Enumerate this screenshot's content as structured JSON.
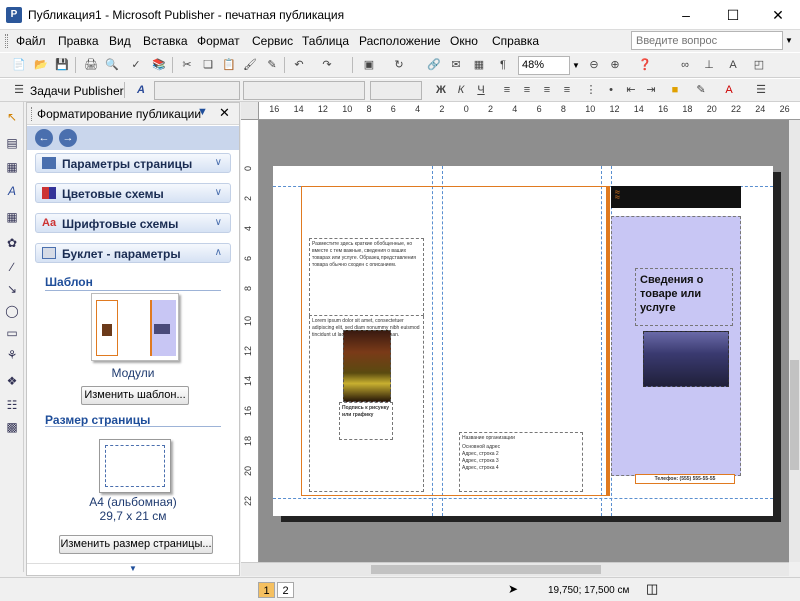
{
  "window": {
    "title": "Публикация1 - Microsoft Publisher - печатная публикация",
    "app_icon": "publisher-icon"
  },
  "menu": {
    "items": [
      "Файл",
      "Правка",
      "Вид",
      "Вставка",
      "Формат",
      "Сервис",
      "Таблица",
      "Расположение",
      "Окно",
      "Справка"
    ],
    "ask_placeholder": "Введите вопрос"
  },
  "toolbar": {
    "zoom": "48%",
    "tasks_label": "Задачи Publisher"
  },
  "taskpane": {
    "title": "Форматирование публикации",
    "sections": [
      {
        "label": "Параметры страницы"
      },
      {
        "label": "Цветовые схемы"
      },
      {
        "label": "Шрифтовые схемы"
      },
      {
        "label": "Буклет - параметры"
      }
    ],
    "template_heading": "Шаблон",
    "template_name": "Модули",
    "change_template": "Изменить шаблон...",
    "pagesize_heading": "Размер страницы",
    "pagesize_name": "A4 (альбомная)",
    "pagesize_dims": "29,7 x 21 см",
    "change_pagesize": "Изменить размер страницы..."
  },
  "rulers": {
    "h": [
      "18",
      "16",
      "14",
      "12",
      "10",
      "8",
      "6",
      "4",
      "2",
      "0",
      "2",
      "4",
      "6",
      "8",
      "10",
      "12",
      "14",
      "16",
      "18",
      "20",
      "22",
      "24",
      "26",
      "28",
      "30"
    ],
    "v": [
      "0",
      "2",
      "4",
      "6",
      "8",
      "10",
      "12",
      "14",
      "16",
      "18",
      "20",
      "22"
    ]
  },
  "document": {
    "heading": "Сведения о товаре или услуге",
    "left_text_1": "Разместите здесь краткие обобщенные, но вместе с тем важные, сведения о ваших товарах или услуге. Образец представления товара обычно сходен с описанием.",
    "left_text_2": "Lorem ipsum dolor sit amet, consectetuer adipiscing elit, sed diam nonummy nibh euismod tincidunt ut laoreet dolore et accumsan.",
    "caption": "Подпись к рисунку или графику",
    "phone": "Телефон: (555) 555-55-55",
    "address_lines": [
      "Название организации",
      "Основной адрес",
      "Адрес, строка 2",
      "Адрес, строка 3",
      "Адрес, строка 4"
    ]
  },
  "status": {
    "pages": [
      "1",
      "2"
    ],
    "coords": "19,750; 17,500 см"
  },
  "colors": {
    "accent": "#1f4e9a",
    "lavender": "#c8c6f4",
    "orange": "#e07a20"
  }
}
